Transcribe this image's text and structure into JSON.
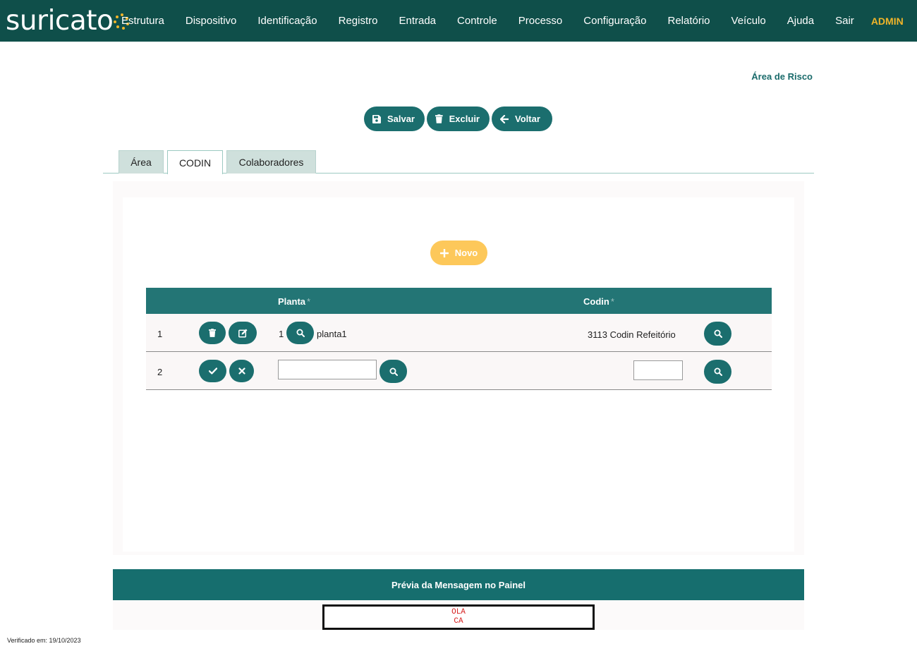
{
  "header": {
    "logo_text": "suricato",
    "nav": [
      "Estrutura",
      "Dispositivo",
      "Identificação",
      "Registro",
      "Entrada",
      "Controle",
      "Processo",
      "Configuração",
      "Relatório",
      "Veículo",
      "Ajuda",
      "Sair"
    ],
    "user": "ADMIN",
    "bg_color": "#0f4f4a",
    "accent_color": "#f0b429"
  },
  "page": {
    "title": "Área de Risco"
  },
  "toolbar": {
    "save_label": "Salvar",
    "delete_label": "Excluir",
    "back_label": "Voltar",
    "button_color": "#1b6e6e"
  },
  "tabs": [
    {
      "label": "Área",
      "active": false
    },
    {
      "label": "CODIN",
      "active": true
    },
    {
      "label": "Colaboradores",
      "active": false
    }
  ],
  "codin": {
    "new_label": "Novo",
    "new_button_color": "#fdc85a",
    "columns": {
      "planta": "Planta",
      "codin": "Codin",
      "required_marker": "*"
    },
    "rows": [
      {
        "index": "1",
        "planta_id": "1",
        "planta_name": "planta1",
        "codin": "3113 Codin Refeitório",
        "mode": "view",
        "actions": [
          "trash-icon",
          "edit-icon"
        ]
      },
      {
        "index": "2",
        "planta_value": "",
        "codin_value": "",
        "mode": "edit",
        "actions": [
          "check-icon",
          "close-icon"
        ]
      }
    ]
  },
  "preview": {
    "title": "Prévia da Mensagem no Painel",
    "lines": [
      "OLA",
      "CA"
    ],
    "text_color": "#d62020"
  },
  "footer": {
    "verified": "Verificado em: 19/10/2023"
  }
}
